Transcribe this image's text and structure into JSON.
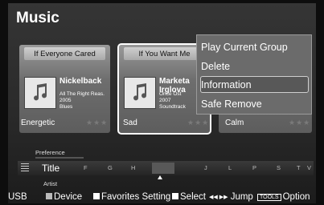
{
  "page": {
    "title": "Music"
  },
  "cards": [
    {
      "header": "If Everyone Cared",
      "artist": "Nickelback",
      "meta": [
        "All The Right Reas..",
        "2005",
        "Blues"
      ],
      "mood": "Energetic",
      "stars": "★★★"
    },
    {
      "header": "If You Want Me",
      "artist": "Marketa Irglova",
      "meta": [
        "Once Ost",
        "2007",
        "Soundtrack"
      ],
      "mood": "Sad",
      "stars": "★★★"
    },
    {
      "header": "",
      "artist": "",
      "meta": [],
      "mood": "Calm",
      "stars": "★★★"
    }
  ],
  "context_menu": {
    "items": [
      "Play Current Group",
      "Delete",
      "Information",
      "Safe Remove"
    ],
    "selected_index": 2
  },
  "sort_bar": {
    "upper_label": "Preference",
    "current": "Title",
    "lower_label": "Artist",
    "letters": [
      "F",
      "G",
      "H",
      "J",
      "L",
      "P",
      "S",
      "T",
      "V"
    ]
  },
  "footer": {
    "source": "USB",
    "device": "Device",
    "favorites": "Favorites Setting",
    "select": "Select",
    "jump_icon": "◀◀ ▶▶",
    "jump": "Jump",
    "tools": "TOOLS",
    "option": "Option"
  },
  "colors": {
    "background": "#2a2a2a",
    "menu": "#6b6b6b",
    "highlight": "#cfcfcf"
  }
}
